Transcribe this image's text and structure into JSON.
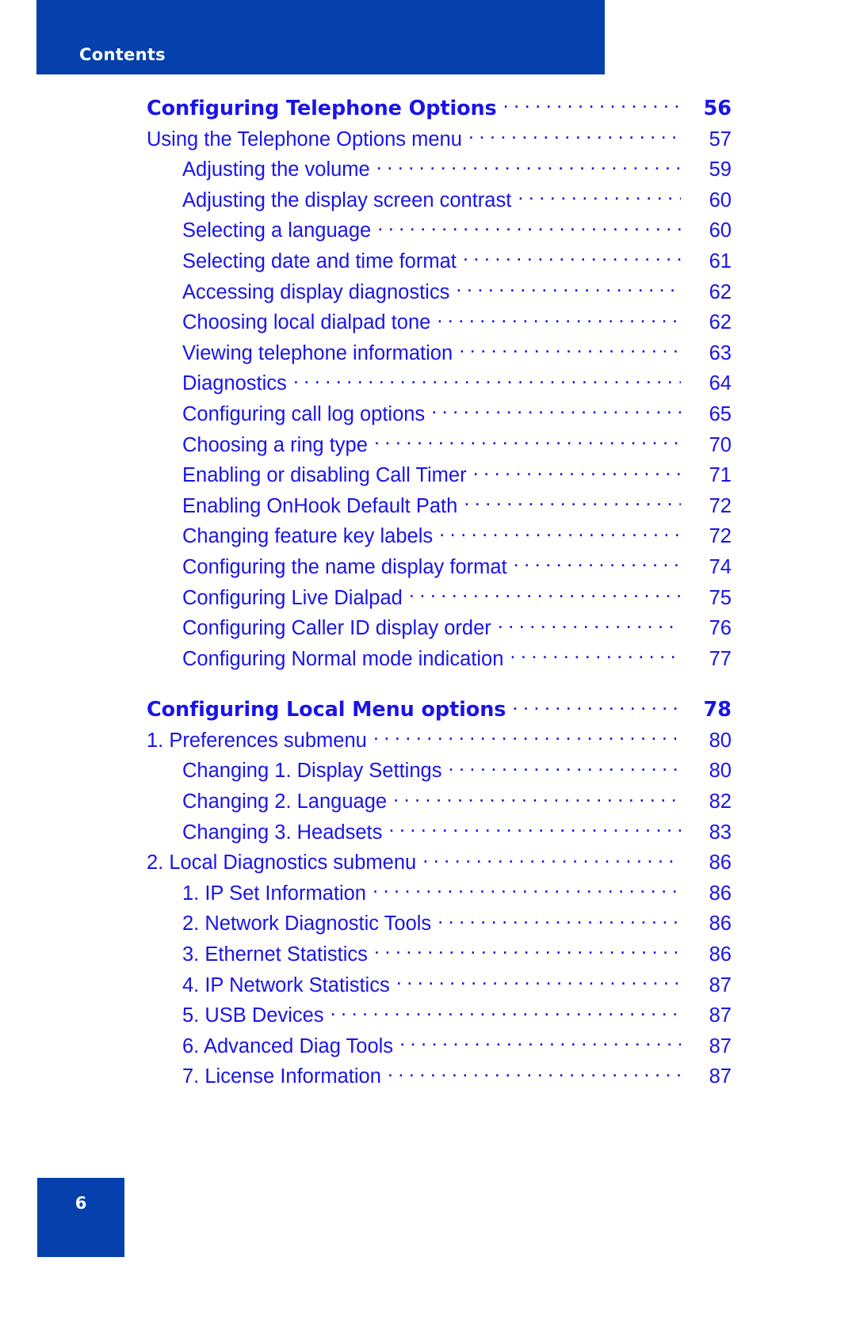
{
  "header": {
    "title": "Contents",
    "bar_color": "#0540ad"
  },
  "footer": {
    "page_number": "6",
    "box_color": "#0540ad"
  },
  "colors": {
    "brand_blue": "#0540ad",
    "link_blue": "#1a14e8"
  },
  "toc": {
    "entries": [
      {
        "label": "Configuring Telephone Options",
        "page": "56",
        "level": 1,
        "bold": true,
        "gap": false
      },
      {
        "label": "Using the Telephone Options menu",
        "page": "57",
        "level": 1,
        "bold": false,
        "gap": false
      },
      {
        "label": "Adjusting the volume",
        "page": "59",
        "level": 2,
        "bold": false,
        "gap": false
      },
      {
        "label": "Adjusting the display screen contrast",
        "page": "60",
        "level": 2,
        "bold": false,
        "gap": false
      },
      {
        "label": "Selecting a language",
        "page": "60",
        "level": 2,
        "bold": false,
        "gap": false
      },
      {
        "label": "Selecting date and time format",
        "page": "61",
        "level": 2,
        "bold": false,
        "gap": false
      },
      {
        "label": "Accessing display diagnostics",
        "page": "62",
        "level": 2,
        "bold": false,
        "gap": false
      },
      {
        "label": "Choosing local dialpad tone",
        "page": "62",
        "level": 2,
        "bold": false,
        "gap": false
      },
      {
        "label": "Viewing telephone information",
        "page": "63",
        "level": 2,
        "bold": false,
        "gap": false
      },
      {
        "label": "Diagnostics",
        "page": "64",
        "level": 2,
        "bold": false,
        "gap": false
      },
      {
        "label": "Configuring call log options",
        "page": "65",
        "level": 2,
        "bold": false,
        "gap": false
      },
      {
        "label": "Choosing a ring type",
        "page": "70",
        "level": 2,
        "bold": false,
        "gap": false
      },
      {
        "label": "Enabling or disabling Call Timer",
        "page": "71",
        "level": 2,
        "bold": false,
        "gap": false
      },
      {
        "label": "Enabling OnHook Default Path",
        "page": "72",
        "level": 2,
        "bold": false,
        "gap": false
      },
      {
        "label": "Changing feature key labels",
        "page": "72",
        "level": 2,
        "bold": false,
        "gap": false
      },
      {
        "label": "Configuring the name display format",
        "page": "74",
        "level": 2,
        "bold": false,
        "gap": false
      },
      {
        "label": "Configuring Live Dialpad",
        "page": "75",
        "level": 2,
        "bold": false,
        "gap": false
      },
      {
        "label": "Configuring Caller ID display order",
        "page": "76",
        "level": 2,
        "bold": false,
        "gap": false
      },
      {
        "label": "Configuring Normal mode indication",
        "page": "77",
        "level": 2,
        "bold": false,
        "gap": false
      },
      {
        "label": "Configuring Local Menu options",
        "page": "78",
        "level": 1,
        "bold": true,
        "gap": true
      },
      {
        "label": "1. Preferences submenu",
        "page": "80",
        "level": 1,
        "bold": false,
        "gap": false
      },
      {
        "label": "Changing 1. Display Settings",
        "page": "80",
        "level": 2,
        "bold": false,
        "gap": false
      },
      {
        "label": "Changing 2. Language",
        "page": "82",
        "level": 2,
        "bold": false,
        "gap": false
      },
      {
        "label": "Changing 3. Headsets",
        "page": "83",
        "level": 2,
        "bold": false,
        "gap": false
      },
      {
        "label": "2. Local Diagnostics submenu",
        "page": "86",
        "level": 1,
        "bold": false,
        "gap": false
      },
      {
        "label": "1. IP Set Information",
        "page": "86",
        "level": 2,
        "bold": false,
        "gap": false
      },
      {
        "label": "2. Network Diagnostic Tools",
        "page": "86",
        "level": 2,
        "bold": false,
        "gap": false
      },
      {
        "label": "3. Ethernet Statistics",
        "page": "86",
        "level": 2,
        "bold": false,
        "gap": false
      },
      {
        "label": "4. IP Network Statistics",
        "page": "87",
        "level": 2,
        "bold": false,
        "gap": false
      },
      {
        "label": "5. USB Devices",
        "page": "87",
        "level": 2,
        "bold": false,
        "gap": false
      },
      {
        "label": "6. Advanced Diag Tools",
        "page": "87",
        "level": 2,
        "bold": false,
        "gap": false
      },
      {
        "label": "7. License Information",
        "page": "87",
        "level": 2,
        "bold": false,
        "gap": false
      }
    ]
  }
}
